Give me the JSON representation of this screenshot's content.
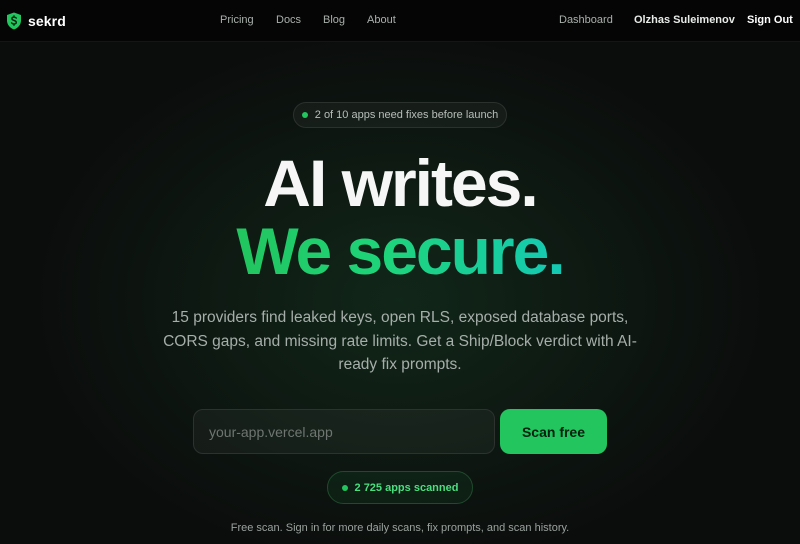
{
  "brand": {
    "name": "sekrd",
    "logo_icon": "shield-dollar-icon",
    "accent": "#22c55e"
  },
  "nav": {
    "links": [
      "Pricing",
      "Docs",
      "Blog",
      "About"
    ],
    "dashboard": "Dashboard",
    "user": "Olzhas Suleimenov",
    "sign_out": "Sign Out"
  },
  "hero": {
    "badge": "2 of 10 apps need fixes before launch",
    "headline_line1": "AI writes.",
    "headline_line2": "We secure.",
    "description": "15 providers find leaked keys, open RLS, exposed database ports, CORS gaps, and missing rate limits. Get a Ship/Block verdict with AI-ready fix prompts.",
    "input_placeholder": "your-app.vercel.app",
    "input_value": "",
    "scan_button": "Scan free",
    "apps_scanned": "2 725 apps scanned",
    "note": "Free scan. Sign in for more daily scans, fix prompts, and scan history."
  }
}
